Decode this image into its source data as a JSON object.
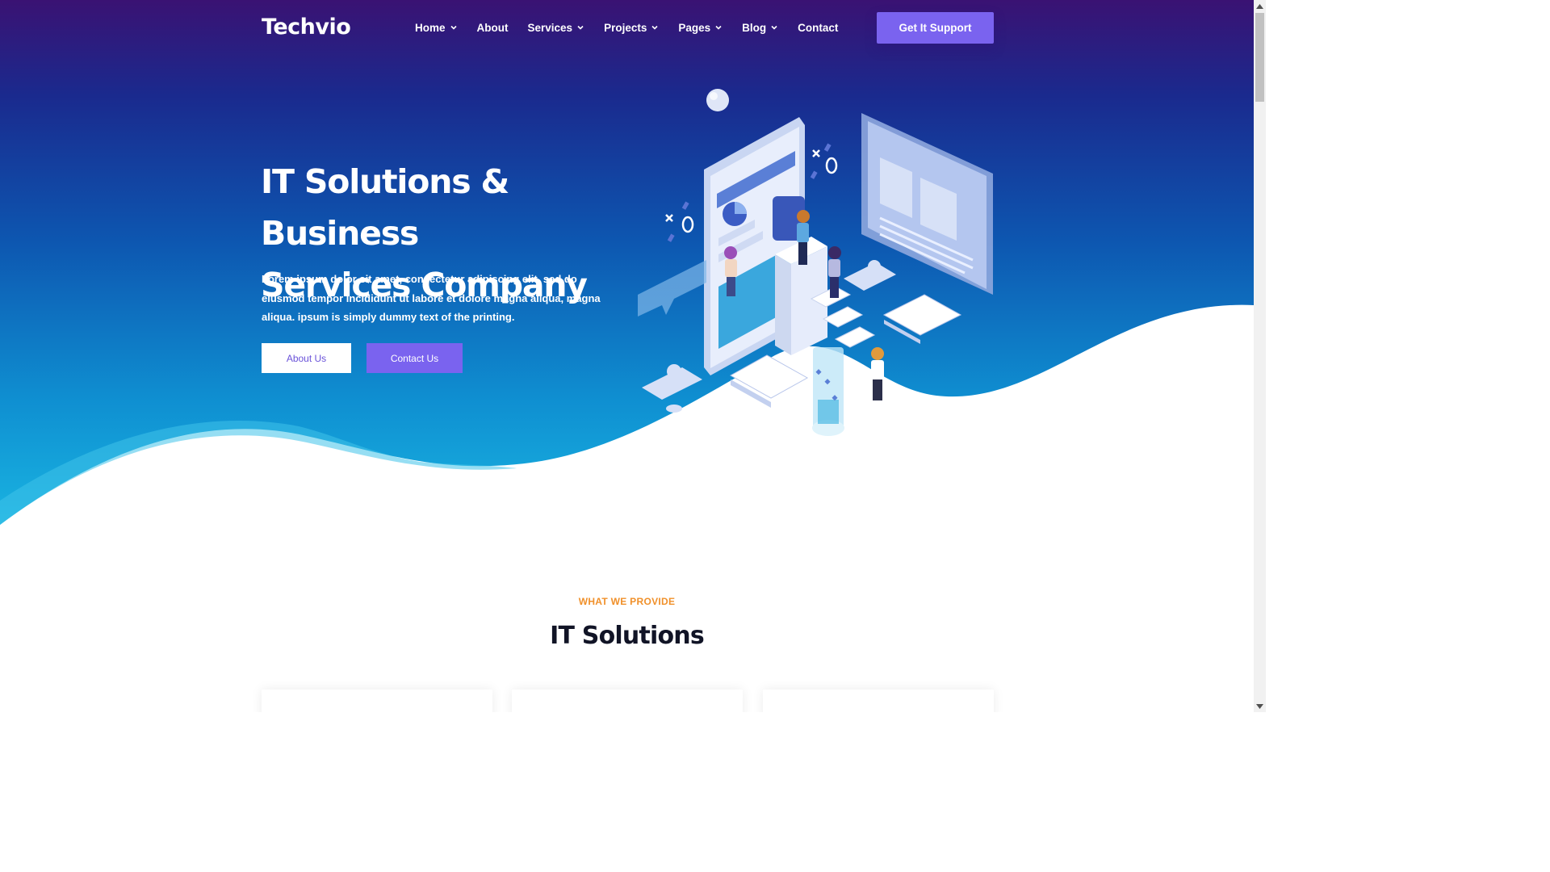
{
  "brand": {
    "name": "Techvio"
  },
  "nav": {
    "items": [
      {
        "label": "Home",
        "dropdown": true
      },
      {
        "label": "About",
        "dropdown": false
      },
      {
        "label": "Services",
        "dropdown": true
      },
      {
        "label": "Projects",
        "dropdown": true
      },
      {
        "label": "Pages",
        "dropdown": true
      },
      {
        "label": "Blog",
        "dropdown": true
      },
      {
        "label": "Contact",
        "dropdown": false
      }
    ],
    "cta_label": "Get It Support"
  },
  "hero": {
    "title_line1": "IT Solutions & Business",
    "title_line2": "Services Company",
    "text": "Lorem ipsum dolor sit amet, consectetur adipiscing elit, sed do eiusmod tempor incididunt ut labore et dolore magna aliqua, magna aliqua. ipsum is simply dummy text of the printing.",
    "about_label": "About Us",
    "contact_label": "Contact Us"
  },
  "section": {
    "eyebrow": "WHAT WE PROVIDE",
    "title": "IT Solutions"
  },
  "colors": {
    "accent": "#7a63ef",
    "eyebrow": "#f0902a",
    "hero_top": "#3a1273",
    "hero_bottom": "#1ab6e2"
  },
  "icons": [
    "chevron-down-icon",
    "scroll-up-icon",
    "scroll-down-icon"
  ]
}
